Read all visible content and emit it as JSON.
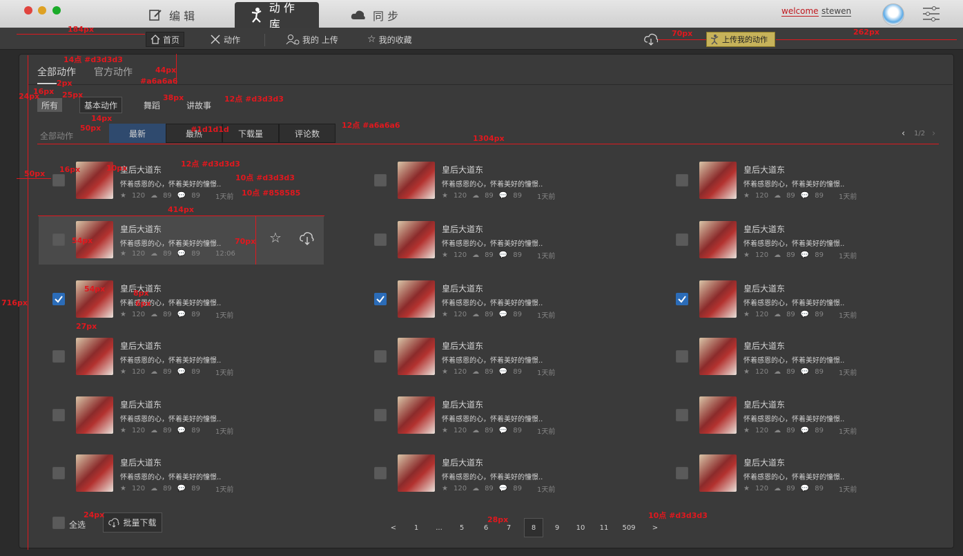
{
  "window": {
    "tabs": [
      {
        "label": "编 辑",
        "icon": "pencil-icon"
      },
      {
        "label": "动 作 库",
        "icon": "dancer-icon"
      },
      {
        "label": "同 步",
        "icon": "cloud-icon"
      }
    ],
    "welcome": "welcome",
    "user": "stewen"
  },
  "subnav": {
    "items": [
      {
        "label": "首页",
        "icon": "home-icon"
      },
      {
        "label": "动作",
        "icon": "tools-icon"
      },
      {
        "label": "我的 上传",
        "icon": "user-upload-icon"
      },
      {
        "label": "我的收藏",
        "icon": "star-icon"
      }
    ],
    "upload_button": "上传我的动作"
  },
  "filters": {
    "top_tabs": [
      "全部动作",
      "官方动作"
    ],
    "categories": [
      "所有",
      "基本动作",
      "舞蹈",
      "讲故事"
    ],
    "sort_label": "全部动作",
    "sort_tabs": [
      "最新",
      "最热",
      "下载量",
      "评论数"
    ],
    "page_indicator": "1/2"
  },
  "card": {
    "title": "皇后大道东",
    "desc": "怀着感恩的心，怀着美好的憧憬..",
    "stars": "120",
    "downloads": "89",
    "comments": "89",
    "time": "1天前",
    "hover_time": "12:06"
  },
  "bottom": {
    "select_all": "全选",
    "batch_download": "批量下载",
    "pages": [
      "<",
      "1",
      "...",
      "5",
      "6",
      "7",
      "8",
      "9",
      "10",
      "11",
      "509",
      ">"
    ],
    "current_page": "8"
  },
  "annotations": [
    "184px",
    "70px",
    "262px",
    "14点 #d3d3d3",
    "44px",
    "#a6a6a6",
    "2px",
    "16px",
    "25px",
    "24px",
    "38px",
    "12点 #d3d3d3",
    "14px",
    "50px",
    "#1d1d1d",
    "12点 #a6a6a6",
    "1304px",
    "50px",
    "16px",
    "10px",
    "12点 #d3d3d3",
    "10点 #d3d3d3",
    "10点 #858585",
    "414px",
    "54px",
    "70px",
    "716px",
    "54px",
    "8px",
    "6px",
    "27px",
    "24px",
    "28px",
    "10点 #d3d3d3"
  ]
}
